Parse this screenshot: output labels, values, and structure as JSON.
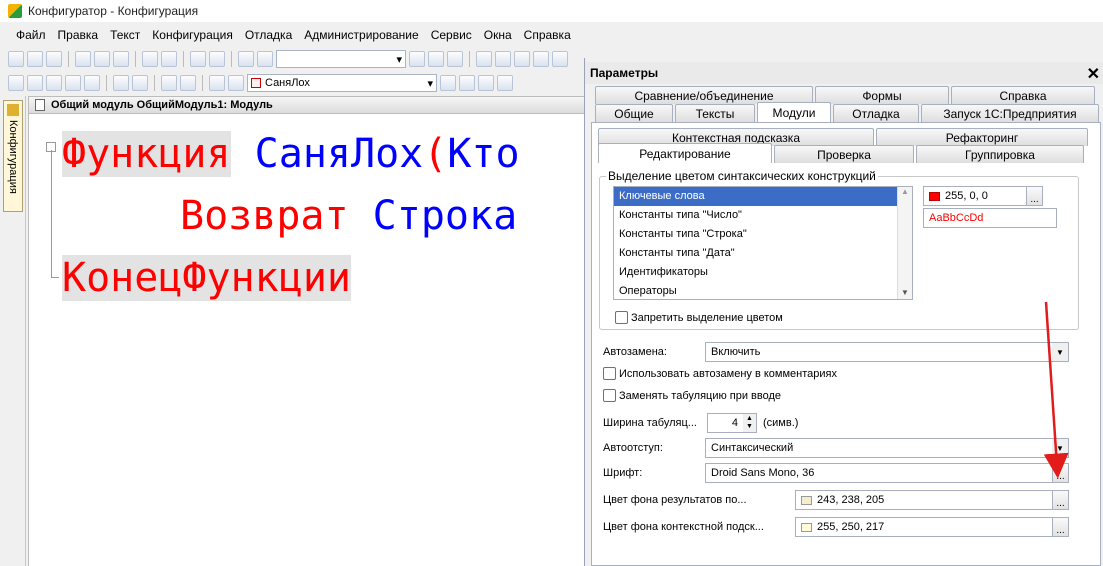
{
  "window": {
    "title": "Конфигуратор - Конфигурация"
  },
  "menu": [
    "Файл",
    "Правка",
    "Текст",
    "Конфигурация",
    "Отладка",
    "Администрирование",
    "Сервис",
    "Окна",
    "Справка"
  ],
  "toolbar": {
    "proc_combo": "СаняЛох"
  },
  "sidebar": {
    "tab_label": "Конфигурация"
  },
  "editor": {
    "title": "Общий модуль ОбщийМодуль1: Модуль",
    "line1": {
      "kw": "Функция",
      "name": "СаняЛох",
      "paren": "(",
      "rest": "Кто"
    },
    "line2": {
      "kw": "Возврат",
      "rest": "Строка"
    },
    "line3": {
      "kw": "КонецФункции"
    }
  },
  "dialog": {
    "title": "Параметры",
    "tabs_row1": [
      "Сравнение/объединение",
      "Формы",
      "Справка"
    ],
    "tabs_row2": [
      "Общие",
      "Тексты",
      "Модули",
      "Отладка",
      "Запуск 1С:Предприятия"
    ],
    "tabs_row2_selected": "Модули",
    "subtabs_row1": [
      "Контекстная подсказка",
      "Рефакторинг"
    ],
    "subtabs_row2": [
      "Редактирование",
      "Проверка",
      "Группировка"
    ],
    "subtabs_row2_selected": "Редактирование",
    "syntax_group_title": "Выделение цветом синтаксических конструкций",
    "syntax_items": [
      "Ключевые слова",
      "Константы типа \"Число\"",
      "Константы типа \"Строка\"",
      "Константы типа \"Дата\"",
      "Идентификаторы",
      "Операторы"
    ],
    "syntax_selected": "Ключевые слова",
    "color_value": "255, 0, 0",
    "color_hex": "#ff0000",
    "sample_text": "AaBbCcDd",
    "disable_highlight": "Запретить выделение цветом",
    "autoreplace_label": "Автозамена:",
    "autoreplace_value": "Включить",
    "use_autoreplace_comments": "Использовать автозамену в комментариях",
    "replace_tabs": "Заменять табуляцию при вводе",
    "tab_width_label": "Ширина табуляц...",
    "tab_width_value": "4",
    "tab_width_unit": "(симв.)",
    "autoindent_label": "Автоотступ:",
    "autoindent_value": "Синтаксический",
    "font_label": "Шрифт:",
    "font_value": "Droid Sans Mono, 36",
    "results_bg_label": "Цвет фона результатов по...",
    "results_bg_value": "243, 238, 205",
    "results_bg_hex": "#f3eecd",
    "context_bg_label": "Цвет фона контекстной подск...",
    "context_bg_value": "255, 250, 217",
    "context_bg_hex": "#fffad9",
    "dots": "..."
  }
}
